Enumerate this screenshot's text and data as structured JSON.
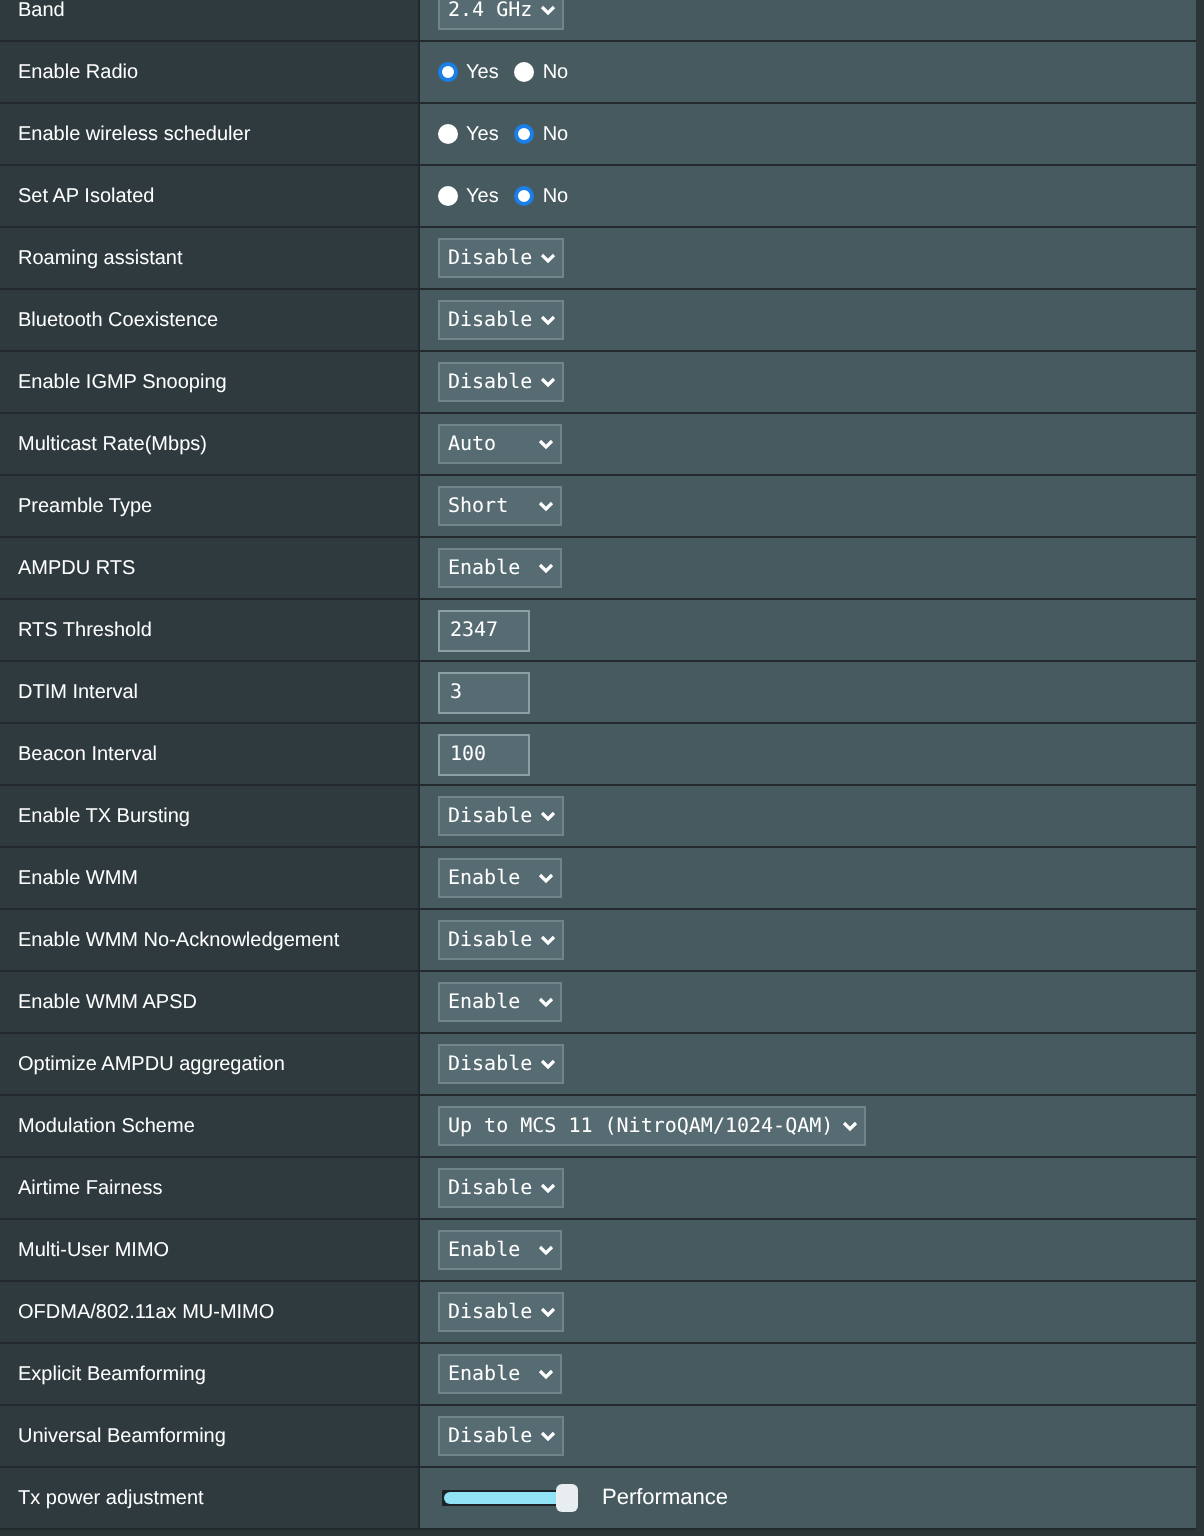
{
  "rows": [
    {
      "label": "Band",
      "kind": "select",
      "value": "2.4 GHz"
    },
    {
      "label": "Enable Radio",
      "kind": "radio",
      "options": [
        {
          "label": "Yes",
          "selected": true
        },
        {
          "label": "No",
          "selected": false
        }
      ]
    },
    {
      "label": "Enable wireless scheduler",
      "kind": "radio",
      "options": [
        {
          "label": "Yes",
          "selected": false
        },
        {
          "label": "No",
          "selected": true
        }
      ]
    },
    {
      "label": "Set AP Isolated",
      "kind": "radio",
      "options": [
        {
          "label": "Yes",
          "selected": false
        },
        {
          "label": "No",
          "selected": true
        }
      ]
    },
    {
      "label": "Roaming assistant",
      "kind": "select",
      "value": "Disable"
    },
    {
      "label": "Bluetooth Coexistence",
      "kind": "select",
      "value": "Disable"
    },
    {
      "label": "Enable IGMP Snooping",
      "kind": "select",
      "value": "Disable"
    },
    {
      "label": "Multicast Rate(Mbps)",
      "kind": "select",
      "value": "Auto"
    },
    {
      "label": "Preamble Type",
      "kind": "select",
      "value": "Short"
    },
    {
      "label": "AMPDU RTS",
      "kind": "select",
      "value": "Enable"
    },
    {
      "label": "RTS Threshold",
      "kind": "input",
      "value": "2347"
    },
    {
      "label": "DTIM Interval",
      "kind": "input",
      "value": "3"
    },
    {
      "label": "Beacon Interval",
      "kind": "input",
      "value": "100"
    },
    {
      "label": "Enable TX Bursting",
      "kind": "select",
      "value": "Disable"
    },
    {
      "label": "Enable WMM",
      "kind": "select",
      "value": "Enable"
    },
    {
      "label": "Enable WMM No-Acknowledgement",
      "kind": "select",
      "value": "Disable"
    },
    {
      "label": "Enable WMM APSD",
      "kind": "select",
      "value": "Enable"
    },
    {
      "label": "Optimize AMPDU aggregation",
      "kind": "select",
      "value": "Disable"
    },
    {
      "label": "Modulation Scheme",
      "kind": "select",
      "value": "Up to MCS 11 (NitroQAM/1024-QAM)"
    },
    {
      "label": "Airtime Fairness",
      "kind": "select",
      "value": "Disable"
    },
    {
      "label": "Multi-User MIMO",
      "kind": "select",
      "value": "Enable"
    },
    {
      "label": "OFDMA/802.11ax MU-MIMO",
      "kind": "select",
      "value": "Disable"
    },
    {
      "label": "Explicit Beamforming",
      "kind": "select",
      "value": "Enable"
    },
    {
      "label": "Universal Beamforming",
      "kind": "select",
      "value": "Disable"
    },
    {
      "label": "Tx power adjustment",
      "kind": "slider",
      "level": 1,
      "reading": "Performance"
    }
  ]
}
